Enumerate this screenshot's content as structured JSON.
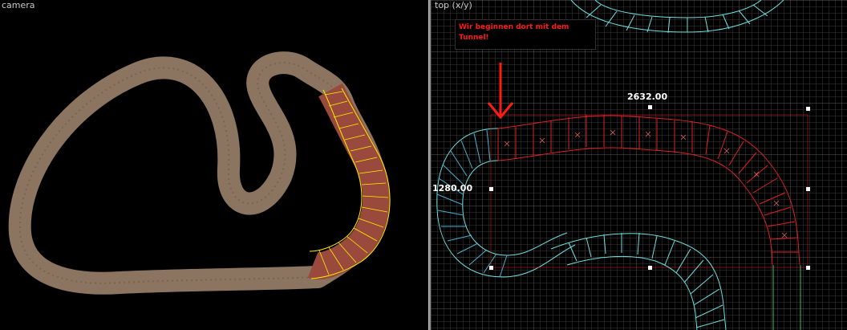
{
  "viewports": {
    "camera": {
      "label": "camera"
    },
    "top": {
      "label": "top (x/y)"
    }
  },
  "annotation": {
    "text": "Wir beginnen dort mit dem Tunnel!",
    "color": "#ff1a1a"
  },
  "dimensions": {
    "width": "2632.00",
    "height": "1280.00"
  },
  "colors": {
    "background": "#000000",
    "track": "#8c7560",
    "selected_track": "#9a4a3c",
    "selection_outline": "#ffee00",
    "grid": "#3a3a3a",
    "grid_major": "#555555",
    "spline_cyan": "#6fe0e0",
    "selection_red": "#e02020"
  },
  "icons": {
    "arrow": "red-down-arrow-icon"
  }
}
